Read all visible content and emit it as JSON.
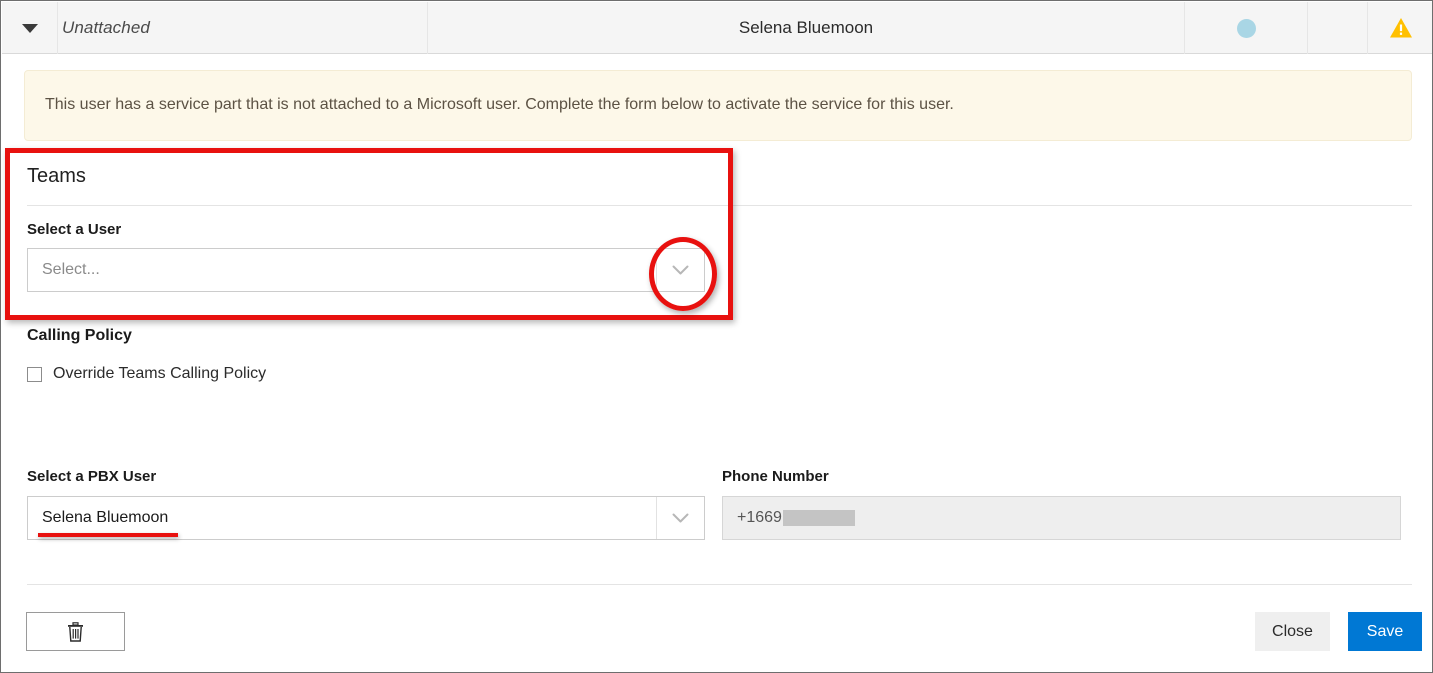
{
  "header": {
    "expander_icon": "caret-down-icon",
    "group_label": "Unattached",
    "user_name": "Selena Bluemoon",
    "status_icon": "status-dot-icon",
    "status_color": "#a9d6e5",
    "warning_icon": "warning-triangle-icon",
    "warning_color": "#ffc000"
  },
  "banner": {
    "message": "This user has a service part that is not attached to a Microsoft user. Complete the form below to activate the service for this user.",
    "background": "#fdf8e9"
  },
  "teams_section": {
    "title": "Teams",
    "select_user": {
      "label": "Select a User",
      "value": "",
      "placeholder": "Select...",
      "chevron_icon": "chevron-down-icon"
    }
  },
  "calling_policy_section": {
    "title": "Calling Policy",
    "override_checkbox": {
      "label": "Override Teams Calling Policy",
      "checked": false
    }
  },
  "pbx_section": {
    "select_pbx_user": {
      "label": "Select a PBX User",
      "value": "Selena Bluemoon",
      "chevron_icon": "chevron-down-icon"
    },
    "phone_number": {
      "label": "Phone Number",
      "value": "+1669",
      "redacted": true,
      "readonly": true
    }
  },
  "footer": {
    "delete_icon": "trash-icon",
    "close_label": "Close",
    "save_label": "Save",
    "save_color": "#0078d4"
  },
  "annotations": {
    "color": "#e8110f",
    "highlight_rect": "teams-section-highlight",
    "highlight_circle": "select-user-dropdown-highlight",
    "underline": "pbx-user-value-underline"
  }
}
